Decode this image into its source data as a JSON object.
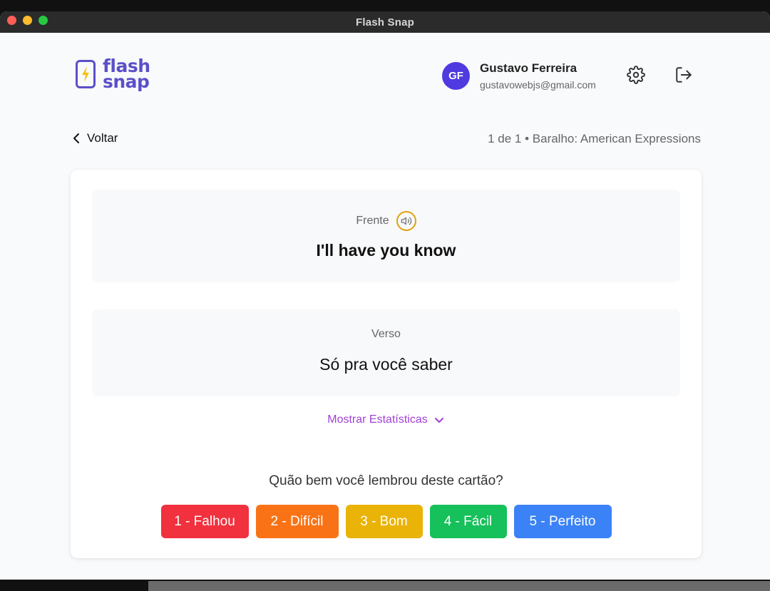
{
  "window": {
    "title": "Flash Snap"
  },
  "logo": {
    "line1": "flash",
    "line2": "snap",
    "icon": "lightning-bolt-icon",
    "brand_color": "#5b50c8"
  },
  "user": {
    "initials": "GF",
    "name": "Gustavo Ferreira",
    "email": "gustavowebjs@gmail.com",
    "avatar_color": "#4f3ae0"
  },
  "header_actions": {
    "settings_icon": "gear-icon",
    "logout_icon": "logout-icon"
  },
  "nav": {
    "back_label": "Voltar",
    "progress_text": "1 de 1 • Baralho: American Expressions"
  },
  "card": {
    "front": {
      "label": "Frente",
      "text": "I'll have you know",
      "audio_icon": "speaker-icon"
    },
    "back": {
      "label": "Verso",
      "text": "Só pra você saber"
    },
    "stats_toggle": "Mostrar Estatísticas",
    "question": "Quão bem você lembrou deste cartão?",
    "ratings": [
      {
        "label": "1 - Falhou",
        "color": "#f1313e"
      },
      {
        "label": "2 - Difícil",
        "color": "#f97316"
      },
      {
        "label": "3 - Bom",
        "color": "#eab308"
      },
      {
        "label": "4 - Fácil",
        "color": "#16c05a"
      },
      {
        "label": "5 - Perfeito",
        "color": "#3b82f6"
      }
    ]
  }
}
